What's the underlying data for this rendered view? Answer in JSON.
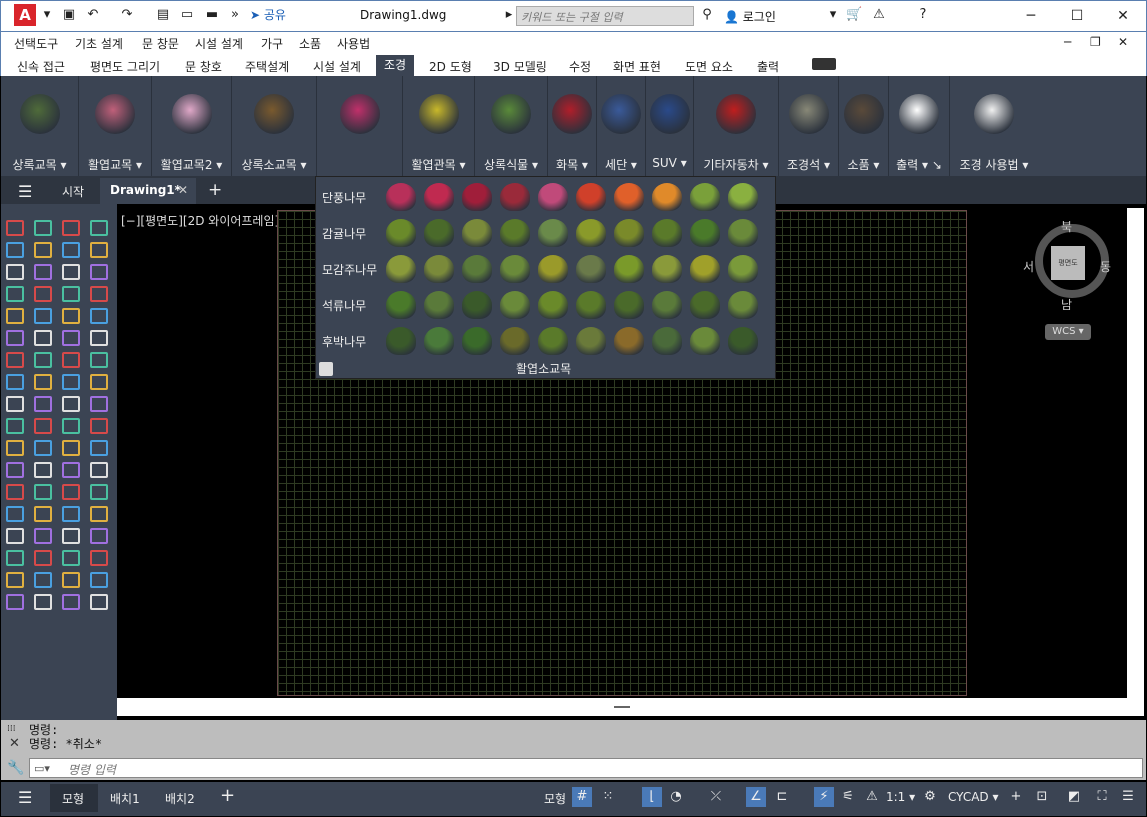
{
  "app": {
    "logo": "A",
    "share": "공유",
    "doc_title": "Drawing1.dwg",
    "search_placeholder": "키워드 또는 구절 입력",
    "login": "로그인"
  },
  "menubar": [
    "선택도구",
    "기초 설계",
    "문 창문",
    "시설 설계",
    "가구",
    "소품",
    "사용법"
  ],
  "ribbon_tabs": [
    "신속 접근",
    "평면도 그리기",
    "문 창호",
    "주택설계",
    "시설 설계",
    "조경",
    "2D 도형",
    "3D 모델링",
    "수정",
    "화면 표현",
    "도면 요소",
    "출력"
  ],
  "active_tab": "조경",
  "ribbon_panels": [
    {
      "label": "상록교목 ▾",
      "color": "#4f6b3a"
    },
    {
      "label": "활엽교목 ▾",
      "color": "#c0607a"
    },
    {
      "label": "활엽교목2 ▾",
      "color": "#e0a8c8"
    },
    {
      "label": "상록소교목 ▾",
      "color": "#7a5a2e"
    },
    {
      "label": "",
      "color": "#c0306a"
    },
    {
      "label": "활엽관목 ▾",
      "color": "#c8b82a"
    },
    {
      "label": "상록식물 ▾",
      "color": "#5a8a3a"
    },
    {
      "label": "화목 ▾",
      "color": "#b01e2a"
    },
    {
      "label": "세단 ▾",
      "color": "#3a5a9a"
    },
    {
      "label": "SUV ▾",
      "color": "#2a4a8a"
    },
    {
      "label": "기타자동차 ▾",
      "color": "#c01e1e"
    },
    {
      "label": "조경석 ▾",
      "color": "#888877"
    },
    {
      "label": "소품 ▾",
      "color": "#5a4a3a"
    },
    {
      "label": "출력 ▾ ↘",
      "color": "#ffffff"
    },
    {
      "label": "조경 사용법 ▾",
      "color": "#f0f0f0"
    }
  ],
  "doc_tabs": {
    "start": "시작",
    "current": "Drawing1*"
  },
  "viewport_label": "[−][평면도][2D 와이어프레임]",
  "compass": {
    "north": "북",
    "south": "남",
    "east": "동",
    "west": "서",
    "cube": "평면도",
    "wcs": "WCS ▾"
  },
  "popup": {
    "rows": [
      {
        "label": "단풍나무",
        "colors": [
          "#b8305a",
          "#c02a50",
          "#a01e3a",
          "#9a2a3a",
          "#c04a7a",
          "#d0402a",
          "#e0602a",
          "#e08a2a",
          "#7aa03a",
          "#8ab040"
        ]
      },
      {
        "label": "감귤나무",
        "colors": [
          "#6a8a2a",
          "#4a6a2a",
          "#7a8a3a",
          "#5a7a2a",
          "#6a8a4a",
          "#8a9a2a",
          "#7a8a2a",
          "#5a7a2a",
          "#4a7a2a",
          "#6a8a3a"
        ]
      },
      {
        "label": "모감주나무",
        "colors": [
          "#8a9a3a",
          "#7a8a3a",
          "#5a7a3a",
          "#6a8a3a",
          "#9a9a2a",
          "#6a7a4a",
          "#7a9a2a",
          "#8a9a3a",
          "#a0a02a",
          "#7a9a3a"
        ]
      },
      {
        "label": "석류나무",
        "colors": [
          "#4a7a2a",
          "#5a7a3a",
          "#3a5a2a",
          "#6a8a3a",
          "#6a8a2a",
          "#5a7a2a",
          "#4a6a2a",
          "#5a7a3a",
          "#4a6a2a",
          "#6a8a3a"
        ]
      },
      {
        "label": "후박나무",
        "colors": [
          "#3a5a2a",
          "#4a7a3a",
          "#3a6a2a",
          "#6a6a2a",
          "#5a7a2a",
          "#6a7a3a",
          "#8a6a2a",
          "#4a6a3a",
          "#6a8a3a",
          "#3a5a2a"
        ]
      }
    ],
    "title": "활엽소교목"
  },
  "command": {
    "history": [
      "명령:",
      "명령: *취소*"
    ],
    "placeholder": "명령 입력"
  },
  "status": {
    "model": "모형",
    "layout1": "배치1",
    "layout2": "배치2",
    "model_btn": "모형",
    "scale": "1:1 ▾",
    "cycad": "CYCAD ▾"
  }
}
